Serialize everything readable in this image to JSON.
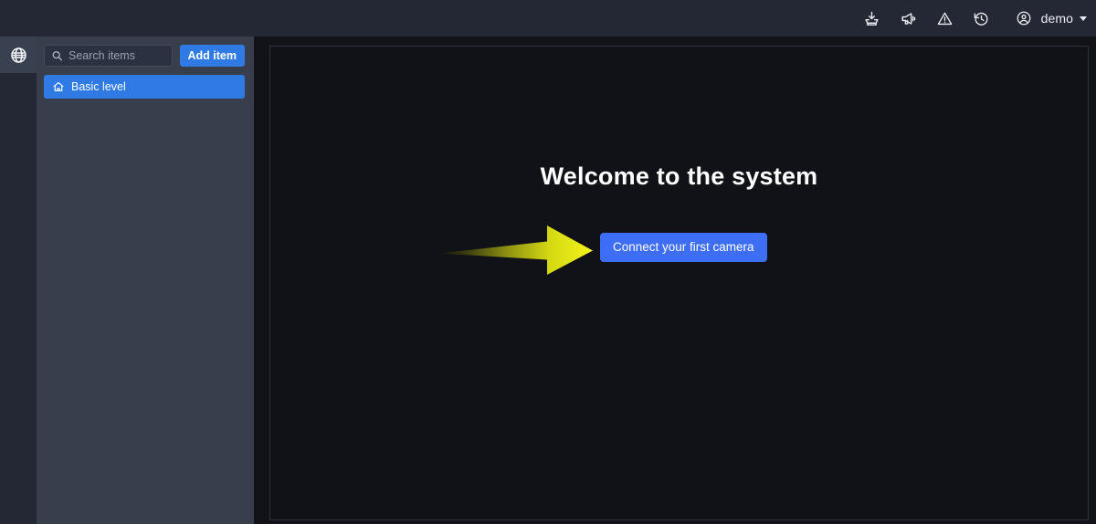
{
  "topbar": {
    "icons": [
      {
        "name": "download-icon",
        "title": "Download"
      },
      {
        "name": "megaphone-icon",
        "title": "Announcements"
      },
      {
        "name": "warning-icon",
        "title": "Alerts"
      },
      {
        "name": "history-icon",
        "title": "History"
      }
    ],
    "user": {
      "icon": "user-circle-icon",
      "label": "demo",
      "caret": "chevron-down-icon"
    }
  },
  "rail": {
    "globe_icon": "globe-icon"
  },
  "sidebar": {
    "search": {
      "icon": "search-icon",
      "value": "",
      "placeholder": "Search items"
    },
    "add_button_label": "Add item",
    "tree": [
      {
        "icon": "home-icon",
        "label": "Basic level",
        "selected": true
      }
    ]
  },
  "main": {
    "title": "Welcome to the system",
    "cta_label": "Connect your first camera",
    "annotation": {
      "type": "arrow",
      "direction": "right",
      "points_to": "Connect your first camera",
      "color_start": "#1a1a08",
      "color_end": "#f2f215"
    }
  },
  "colors": {
    "accent_blue": "#2f7ae5",
    "cta_blue": "#3d6ef5",
    "topbar_bg": "#232834",
    "sidebar_bg": "#383e4c",
    "panel_bg": "#111217",
    "page_bg": "#121318",
    "arrow_yellow": "#f2f215"
  }
}
